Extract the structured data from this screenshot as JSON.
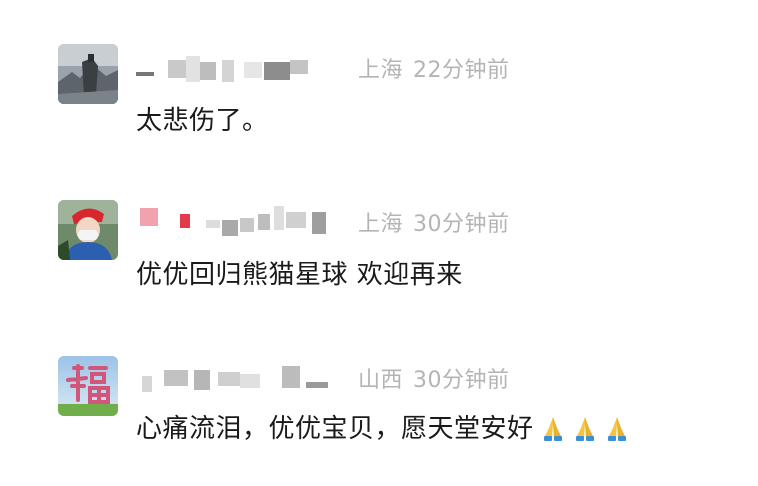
{
  "comments": [
    {
      "location": "上海",
      "time": "22分钟前",
      "text": "太悲伤了。",
      "avatar_desc": "photo-avatar",
      "reactions": []
    },
    {
      "location": "上海",
      "time": "30分钟前",
      "text": "优优回归熊猫星球 欢迎再来",
      "avatar_desc": "photo-avatar",
      "reactions": []
    },
    {
      "location": "山西",
      "time": "30分钟前",
      "text": "心痛流泪，优优宝贝，愿天堂安好",
      "avatar_desc": "fu-character-avatar",
      "reactions": [
        "folded-hands-icon",
        "folded-hands-icon",
        "folded-hands-icon"
      ]
    }
  ],
  "colors": {
    "meta_text": "#b4b4b4",
    "body_text": "#1a1a1a",
    "background": "#ffffff"
  }
}
